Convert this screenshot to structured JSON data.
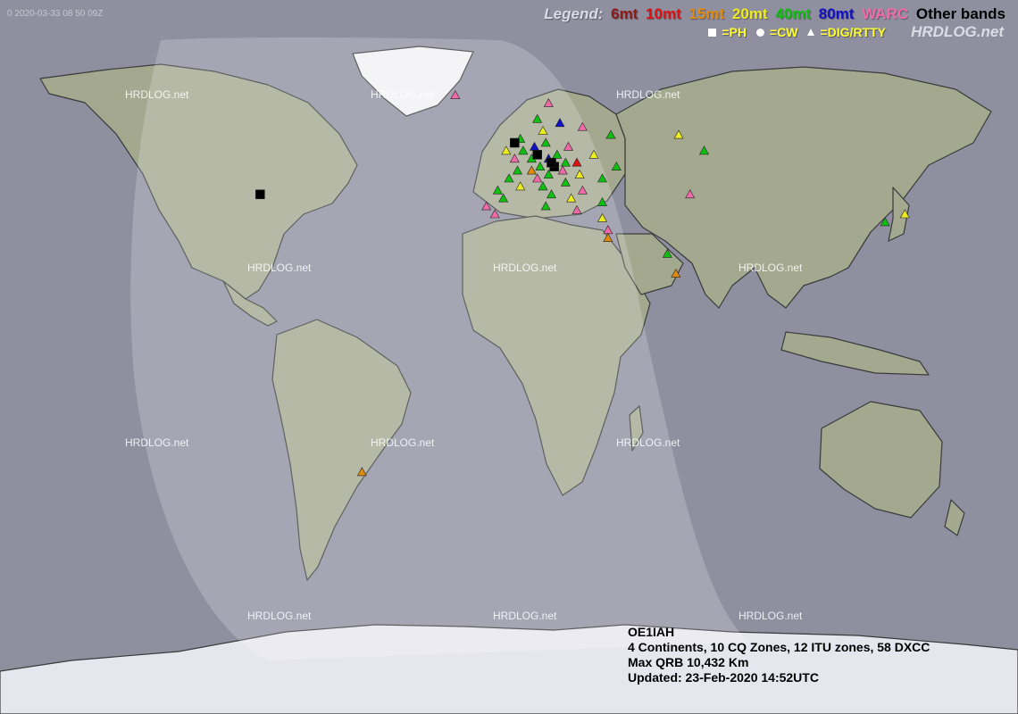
{
  "timestamp": "0 2020-03-33 08 50 09Z",
  "legend": {
    "title": "Legend:",
    "bands": [
      {
        "label": "6mt",
        "color": "#8b1a1a"
      },
      {
        "label": "10mt",
        "color": "#e01010"
      },
      {
        "label": "15mt",
        "color": "#e08a10"
      },
      {
        "label": "20mt",
        "color": "#ecec20"
      },
      {
        "label": "40mt",
        "color": "#10c010"
      },
      {
        "label": "80mt",
        "color": "#1010c8"
      },
      {
        "label": "WARC",
        "color": "#f06aa8"
      },
      {
        "label": "Other bands",
        "color": "#000000"
      }
    ]
  },
  "modes": [
    {
      "symbol": "square",
      "label": "=PH"
    },
    {
      "symbol": "circle",
      "label": "=CW"
    },
    {
      "symbol": "triangle",
      "label": "=DIG/RTTY"
    }
  ],
  "brand": "HRDLOG.net",
  "watermark_text": "HRDLOG.net",
  "stats": {
    "callsign": "OE1IAH",
    "summary": "4 Continents, 10 CQ Zones, 12 ITU zones, 58 DXCC",
    "max_qrb": "Max QRB 10,432 Km",
    "updated": "Updated: 23-Feb-2020 14:52UTC"
  },
  "colors": {
    "ocean": "#8f8fa0",
    "land": "#a3a88f",
    "ice": "#e6e6ee",
    "daylight": "#ffffff"
  },
  "spots": [
    {
      "lat": 64,
      "lon": 14,
      "band": "WARC",
      "mode": "DIG"
    },
    {
      "lat": 60,
      "lon": 10,
      "band": "40mt",
      "mode": "DIG"
    },
    {
      "lat": 59,
      "lon": 18,
      "band": "80mt",
      "mode": "DIG"
    },
    {
      "lat": 58,
      "lon": 26,
      "band": "WARC",
      "mode": "DIG"
    },
    {
      "lat": 57,
      "lon": 12,
      "band": "20mt",
      "mode": "DIG"
    },
    {
      "lat": 56,
      "lon": 36,
      "band": "40mt",
      "mode": "DIG"
    },
    {
      "lat": 55,
      "lon": 4,
      "band": "40mt",
      "mode": "DIG"
    },
    {
      "lat": 54,
      "lon": 13,
      "band": "40mt",
      "mode": "DIG"
    },
    {
      "lat": 53,
      "lon": 9,
      "band": "80mt",
      "mode": "DIG"
    },
    {
      "lat": 53,
      "lon": 21,
      "band": "WARC",
      "mode": "DIG"
    },
    {
      "lat": 52,
      "lon": -1,
      "band": "20mt",
      "mode": "DIG"
    },
    {
      "lat": 52,
      "lon": 5,
      "band": "40mt",
      "mode": "DIG"
    },
    {
      "lat": 51,
      "lon": 17,
      "band": "40mt",
      "mode": "DIG"
    },
    {
      "lat": 51,
      "lon": 30,
      "band": "20mt",
      "mode": "DIG"
    },
    {
      "lat": 50,
      "lon": 2,
      "band": "WARC",
      "mode": "DIG"
    },
    {
      "lat": 50,
      "lon": 8,
      "band": "40mt",
      "mode": "DIG"
    },
    {
      "lat": 50,
      "lon": 14,
      "band": "80mt",
      "mode": "DIG"
    },
    {
      "lat": 49,
      "lon": 20,
      "band": "40mt",
      "mode": "DIG"
    },
    {
      "lat": 49,
      "lon": 24,
      "band": "10mt",
      "mode": "DIG"
    },
    {
      "lat": 48,
      "lon": 16,
      "band": "Other bands",
      "mode": "PH"
    },
    {
      "lat": 48,
      "lon": 11,
      "band": "40mt",
      "mode": "DIG"
    },
    {
      "lat": 48,
      "lon": 38,
      "band": "40mt",
      "mode": "DIG"
    },
    {
      "lat": 47,
      "lon": 3,
      "band": "40mt",
      "mode": "DIG"
    },
    {
      "lat": 47,
      "lon": 8,
      "band": "15mt",
      "mode": "DIG"
    },
    {
      "lat": 47,
      "lon": 19,
      "band": "WARC",
      "mode": "DIG"
    },
    {
      "lat": 46,
      "lon": 14,
      "band": "40mt",
      "mode": "DIG"
    },
    {
      "lat": 46,
      "lon": 25,
      "band": "20mt",
      "mode": "DIG"
    },
    {
      "lat": 45,
      "lon": 0,
      "band": "40mt",
      "mode": "DIG"
    },
    {
      "lat": 45,
      "lon": 10,
      "band": "WARC",
      "mode": "DIG"
    },
    {
      "lat": 45,
      "lon": 33,
      "band": "40mt",
      "mode": "DIG"
    },
    {
      "lat": 44,
      "lon": 20,
      "band": "40mt",
      "mode": "DIG"
    },
    {
      "lat": 43,
      "lon": 4,
      "band": "20mt",
      "mode": "DIG"
    },
    {
      "lat": 43,
      "lon": 12,
      "band": "40mt",
      "mode": "DIG"
    },
    {
      "lat": 42,
      "lon": -4,
      "band": "40mt",
      "mode": "DIG"
    },
    {
      "lat": 42,
      "lon": 26,
      "band": "WARC",
      "mode": "DIG"
    },
    {
      "lat": 41,
      "lon": 15,
      "band": "40mt",
      "mode": "DIG"
    },
    {
      "lat": 40,
      "lon": -2,
      "band": "40mt",
      "mode": "DIG"
    },
    {
      "lat": 40,
      "lon": 22,
      "band": "20mt",
      "mode": "DIG"
    },
    {
      "lat": 39,
      "lon": 33,
      "band": "40mt",
      "mode": "DIG"
    },
    {
      "lat": 38,
      "lon": -8,
      "band": "WARC",
      "mode": "DIG"
    },
    {
      "lat": 38,
      "lon": 13,
      "band": "40mt",
      "mode": "DIG"
    },
    {
      "lat": 37,
      "lon": 24,
      "band": "WARC",
      "mode": "DIG"
    },
    {
      "lat": 36,
      "lon": -5,
      "band": "WARC",
      "mode": "DIG"
    },
    {
      "lat": 35,
      "lon": 33,
      "band": "20mt",
      "mode": "DIG"
    },
    {
      "lat": 32,
      "lon": 35,
      "band": "WARC",
      "mode": "DIG"
    },
    {
      "lat": 30,
      "lon": 35,
      "band": "15mt",
      "mode": "DIG"
    },
    {
      "lat": 54,
      "lon": 2,
      "band": "Other bands",
      "mode": "PH"
    },
    {
      "lat": 51,
      "lon": 10,
      "band": "Other bands",
      "mode": "PH"
    },
    {
      "lat": 49,
      "lon": 15,
      "band": "Other bands",
      "mode": "PH"
    },
    {
      "lat": 56,
      "lon": 60,
      "band": "20mt",
      "mode": "DIG"
    },
    {
      "lat": 52,
      "lon": 69,
      "band": "40mt",
      "mode": "DIG"
    },
    {
      "lat": 41,
      "lon": 64,
      "band": "WARC",
      "mode": "DIG"
    },
    {
      "lat": 26,
      "lon": 56,
      "band": "40mt",
      "mode": "DIG"
    },
    {
      "lat": 21,
      "lon": 59,
      "band": "15mt",
      "mode": "DIG"
    },
    {
      "lat": 66,
      "lon": -19,
      "band": "WARC",
      "mode": "DIG"
    },
    {
      "lat": 41,
      "lon": -88,
      "band": "Other bands",
      "mode": "PH"
    },
    {
      "lat": 36,
      "lon": 140,
      "band": "20mt",
      "mode": "DIG"
    },
    {
      "lat": 34,
      "lon": 133,
      "band": "40mt",
      "mode": "DIG"
    },
    {
      "lat": -29,
      "lon": -52,
      "band": "15mt",
      "mode": "DIG"
    }
  ]
}
